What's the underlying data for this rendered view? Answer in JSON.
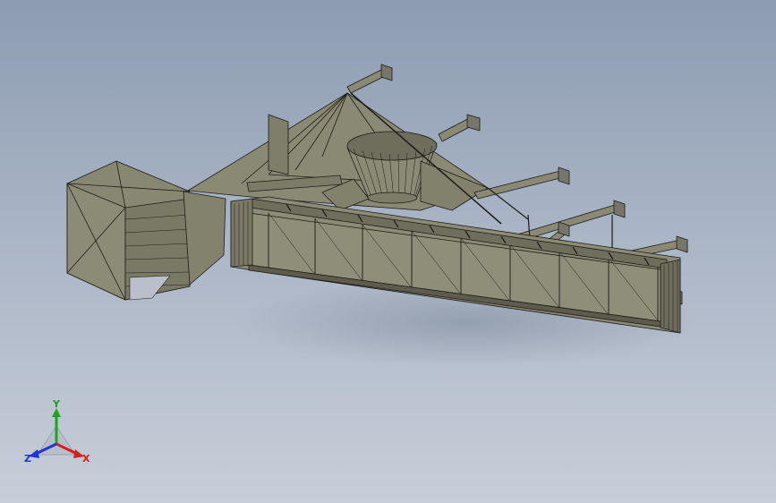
{
  "viewport": {
    "background_top": "#8d9cb2",
    "background_bottom": "#c7ced9",
    "model_face_color": "#86856f",
    "model_edge_color": "#1c1c18"
  },
  "triad": {
    "x_label": "X",
    "y_label": "Y",
    "z_label": "Z",
    "x_color": "#d42020",
    "y_color": "#1fa31f",
    "z_color": "#2035d4"
  }
}
